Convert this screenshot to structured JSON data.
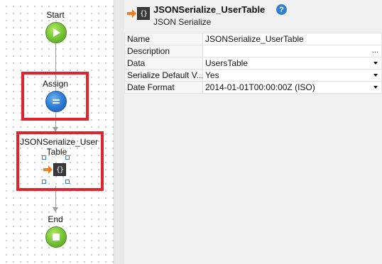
{
  "flow": {
    "start_label": "Start",
    "assign_label": "Assign",
    "assign_icon": "equals-icon",
    "json_node_label": "JSONSerialize_User Table",
    "json_node_icon": "json-serialize-icon",
    "end_label": "End",
    "highlight_color": "#e0232e"
  },
  "panel": {
    "title": "JSONSerialize_UserTable",
    "subtitle": "JSON Serialize",
    "help_glyph": "?",
    "json_icon_glyph": "{}",
    "properties": [
      {
        "name": "Name",
        "value": "JSONSerialize_UserTable",
        "control": "text"
      },
      {
        "name": "Description",
        "value": "",
        "control": "ellipsis",
        "ellipsis": "..."
      },
      {
        "name": "Data",
        "value": "UsersTable",
        "control": "dropdown"
      },
      {
        "name": "Serialize Default V...",
        "value": "Yes",
        "control": "dropdown"
      },
      {
        "name": "Date Format",
        "value": "2014-01-01T00:00:00Z (ISO)",
        "control": "dropdown"
      }
    ]
  }
}
